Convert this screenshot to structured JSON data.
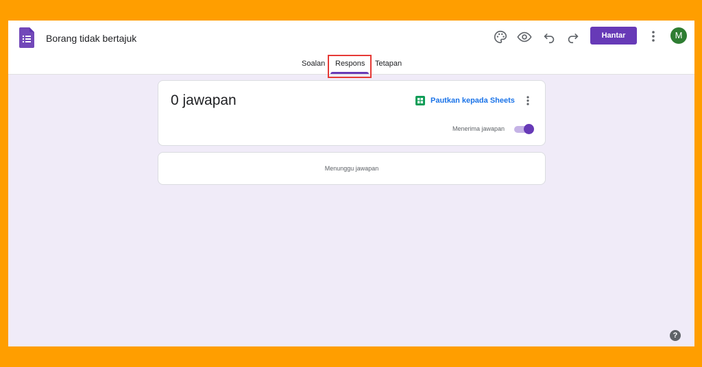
{
  "header": {
    "title": "Borang tidak bertajuk",
    "send_label": "Hantar",
    "avatar_initial": "M",
    "icons": [
      "palette-icon",
      "preview-eye-icon",
      "undo-icon",
      "redo-icon",
      "more-vert-icon"
    ]
  },
  "tabs": [
    {
      "label": "Soalan",
      "active": false
    },
    {
      "label": "Respons",
      "active": true
    },
    {
      "label": "Tetapan",
      "active": false
    }
  ],
  "summary": {
    "count_text": "0 jawapan",
    "sheets_link_label": "Pautkan kepada Sheets",
    "accepting_label": "Menerima jawapan",
    "accepting": true
  },
  "empty_state": {
    "text": "Menunggu jawapan"
  },
  "help_label": "?",
  "colors": {
    "accent": "#673AB7",
    "background": "#F0EBF8",
    "outer_frame": "#FF9E00",
    "link": "#1A73E8",
    "avatar": "#2E7D32",
    "sheets": "#0F9D58",
    "highlight": "#E53935"
  }
}
